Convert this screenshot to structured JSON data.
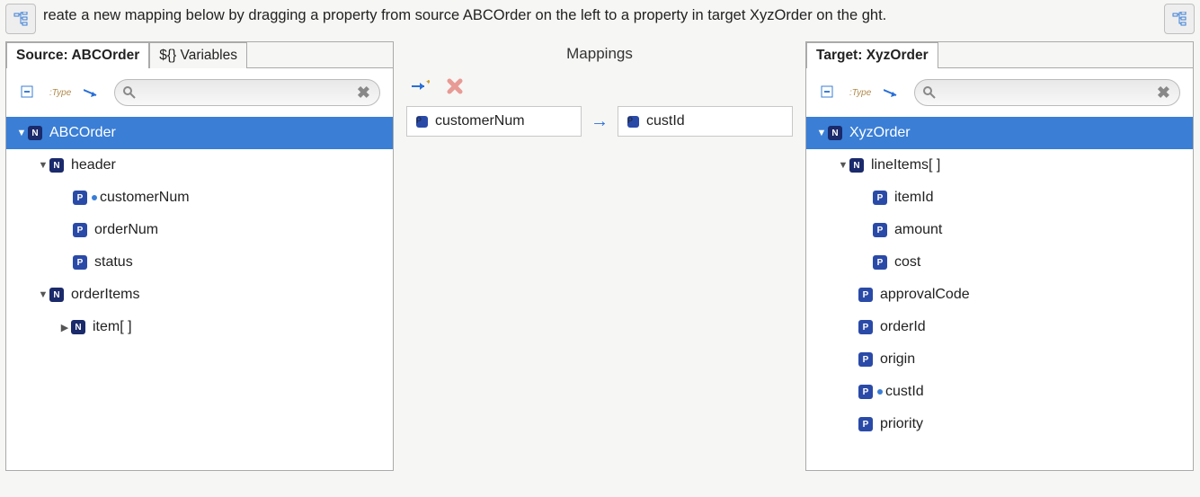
{
  "hint": "reate a new mapping below by dragging a property from source ABCOrder on the left to a property in target XyzOrder  on the ght.",
  "source": {
    "tab_label": "Source: ABCOrder",
    "variables_tab": "${} Variables",
    "type_btn": ":Type",
    "search_placeholder": "",
    "tree": {
      "root": "ABCOrder",
      "header": {
        "label": "header",
        "children": [
          "customerNum",
          "orderNum",
          "status"
        ]
      },
      "orderItems": {
        "label": "orderItems",
        "item": "item[ ]"
      }
    }
  },
  "mappings": {
    "title": "Mappings",
    "from": "customerNum",
    "to": "custId"
  },
  "target": {
    "tab_label": "Target: XyzOrder",
    "type_btn": ":Type",
    "search_placeholder": "",
    "tree": {
      "root": "XyzOrder",
      "lineItems": {
        "label": "lineItems[ ]",
        "children": [
          "itemId",
          "amount",
          "cost"
        ]
      },
      "props": [
        "approvalCode",
        "orderId",
        "origin",
        "custId",
        "priority"
      ]
    }
  }
}
